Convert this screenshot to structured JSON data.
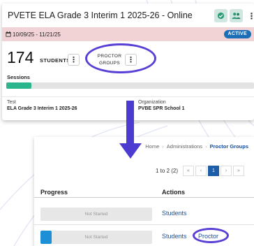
{
  "colors": {
    "accent": "#1c5fa8",
    "annotation": "#5a3fd6",
    "sessions_fill": "#2bb58c",
    "date_bar": "#f2d3d5"
  },
  "card": {
    "title": "PVETE ELA Grade 3 Interim 1 2025-26 - Online",
    "header_icons": [
      "check-badge-icon",
      "group-icon"
    ],
    "menu_glyph": "⋮",
    "date_range": "10/09/25 - 11/21/25",
    "date_icon": "calendar-icon",
    "status": "ACTIVE",
    "student_count": "174",
    "student_unit": "STUDENTS",
    "proctor_groups_line1": "PROCTOR",
    "proctor_groups_line2": "GROUPS",
    "sessions_label": "Sessions",
    "sessions_progress": 0.1,
    "test_label": "Test",
    "test_value": "ELA Grade 3 Interim 1 2025-26",
    "org_label": "Organization",
    "org_value": "PVBE SPR School 1"
  },
  "panel": {
    "breadcrumb": {
      "home": "Home",
      "administrations": "Administrations",
      "current": "Proctor Groups",
      "sep": "›"
    },
    "range": "1 to 2 (2)",
    "pager": {
      "first": "«",
      "prev": "‹",
      "page": "1",
      "next": "›",
      "last": "»"
    },
    "columns": {
      "progress": "Progress",
      "actions": "Actions"
    },
    "rows": [
      {
        "status": "Not Started",
        "fill": 0.0,
        "action": "Students"
      },
      {
        "status": "Not Started",
        "fill": 0.1,
        "action": "Students",
        "action2": "Proctor"
      }
    ]
  }
}
